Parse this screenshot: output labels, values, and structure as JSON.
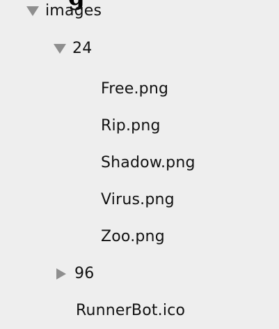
{
  "clipped_title": "g",
  "tree": {
    "root": {
      "label": "images",
      "icon": "triangle-down-icon",
      "expanded": true
    },
    "folder_24": {
      "label": "24",
      "icon": "triangle-down-icon",
      "expanded": true,
      "files": [
        "Free.png",
        "Rip.png",
        "Shadow.png",
        "Virus.png",
        "Zoo.png"
      ]
    },
    "folder_96": {
      "label": "96",
      "icon": "triangle-right-icon",
      "expanded": false
    },
    "root_file": "RunnerBot.ico"
  },
  "colors": {
    "background": "#eeeeee",
    "disclosure_triangle": "#8e8e8e",
    "text": "#111111"
  }
}
